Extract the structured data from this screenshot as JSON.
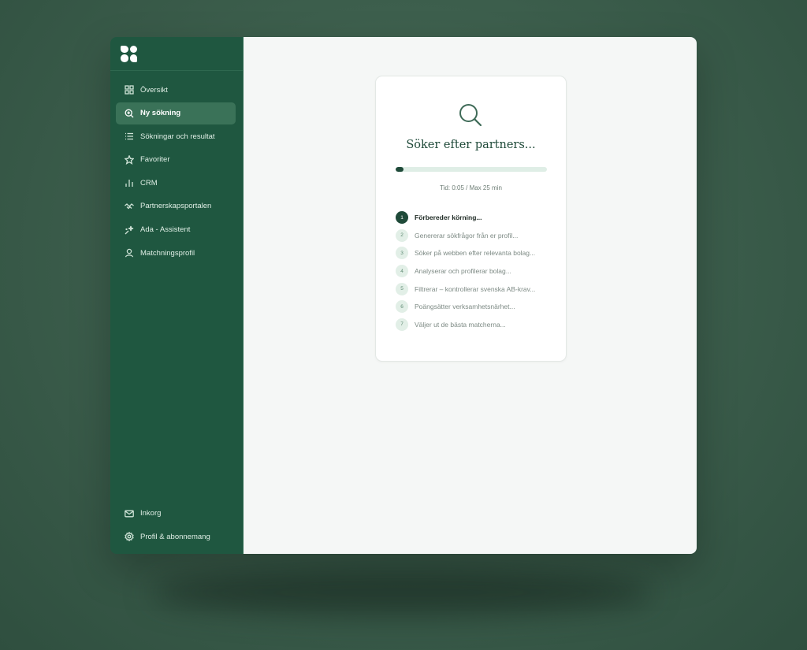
{
  "sidebar": {
    "items": [
      {
        "label": "Översikt",
        "icon": "grid-icon"
      },
      {
        "label": "Ny sökning",
        "icon": "search-plus-icon",
        "active": true
      },
      {
        "label": "Sökningar och resultat",
        "icon": "list-icon"
      },
      {
        "label": "Favoriter",
        "icon": "star-icon"
      },
      {
        "label": "CRM",
        "icon": "bar-chart-icon"
      },
      {
        "label": "Partnerskapsportalen",
        "icon": "handshake-icon"
      },
      {
        "label": "Ada - Assistent",
        "icon": "sparkle-icon"
      },
      {
        "label": "Matchningsprofil",
        "icon": "user-icon"
      }
    ],
    "bottom": [
      {
        "label": "Inkorg",
        "icon": "mail-icon"
      },
      {
        "label": "Profil & abonnemang",
        "icon": "gear-icon"
      }
    ]
  },
  "search_card": {
    "title": "Söker efter partners...",
    "progress_fraction": 0.05,
    "timer": "Tid: 0:05  /  Max 25 min",
    "steps": [
      {
        "num": "1",
        "label": "Förbereder körning...",
        "active": true
      },
      {
        "num": "2",
        "label": "Genererar sökfrågor från er profil..."
      },
      {
        "num": "3",
        "label": "Söker på webben efter relevanta bolag..."
      },
      {
        "num": "4",
        "label": "Analyserar och profilerar bolag..."
      },
      {
        "num": "5",
        "label": "Filtrerar – kontrollerar svenska AB-krav..."
      },
      {
        "num": "6",
        "label": "Poängsätter verksamhetsnärhet..."
      },
      {
        "num": "7",
        "label": "Väljer ut de bästa matcherna..."
      }
    ]
  },
  "colors": {
    "sidebar_bg": "#1f5740",
    "accent": "#1f4a39",
    "step_badge": "#e2efe7"
  }
}
